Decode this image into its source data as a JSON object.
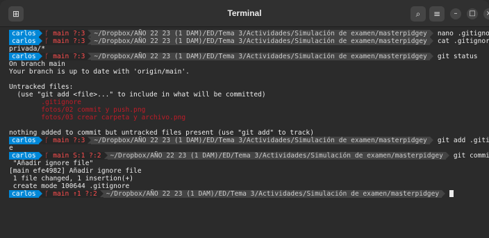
{
  "window": {
    "title": "Terminal",
    "icons": {
      "new_tab": "tab-icon",
      "search": "search-icon",
      "menu": "hamburger-menu-icon",
      "minimize": "minimize-icon",
      "maximize": "maximize-icon",
      "close": "close-icon"
    }
  },
  "prompt": {
    "user": "carlos",
    "branch_symbol": "ᚴ",
    "path": "~/Dropbox/AÑO 22 23 (1 DAM)/ED/Tema 3/Actividades/Simulación de examen/masterpidgey",
    "colors": {
      "user_bg": "#0087d7",
      "branch_bg": "#262626",
      "branch_fg": "#ff4e4e",
      "path_bg": "#444444"
    }
  },
  "lines": [
    {
      "type": "prompt",
      "git": "main ?:3",
      "cmd": "nano .gitignore"
    },
    {
      "type": "prompt",
      "git": "main ?:3",
      "cmd": "cat .gitignore"
    },
    {
      "type": "out",
      "text": "privada/*"
    },
    {
      "type": "prompt",
      "git": "main ?:3",
      "cmd": "git status"
    },
    {
      "type": "out",
      "text": "On branch main"
    },
    {
      "type": "out",
      "text": "Your branch is up to date with 'origin/main'."
    },
    {
      "type": "out",
      "text": ""
    },
    {
      "type": "out",
      "text": "Untracked files:"
    },
    {
      "type": "out",
      "text": "  (use \"git add <file>...\" to include in what will be committed)"
    },
    {
      "type": "red",
      "text": "        .gitignore"
    },
    {
      "type": "red",
      "text": "        fotos/02 commit y push.png"
    },
    {
      "type": "red",
      "text": "        fotos/03 crear carpeta y archivo.png"
    },
    {
      "type": "out",
      "text": ""
    },
    {
      "type": "out",
      "text": "nothing added to commit but untracked files present (use \"git add\" to track)"
    },
    {
      "type": "prompt",
      "git": "main ?:3",
      "cmd": "git add .gitignor"
    },
    {
      "type": "out",
      "text": "e"
    },
    {
      "type": "prompt",
      "git": "main S:1 ?:2",
      "cmd": "git commit -m"
    },
    {
      "type": "out",
      "text": " \"Añadir ignore file\""
    },
    {
      "type": "out",
      "text": "[main efe4982] Añadir ignore file"
    },
    {
      "type": "out",
      "text": " 1 file changed, 1 insertion(+)"
    },
    {
      "type": "out",
      "text": " create mode 100644 .gitignore"
    },
    {
      "type": "prompt",
      "git": "main ↑1 ?:2",
      "cmd": "",
      "cursor": true
    }
  ]
}
